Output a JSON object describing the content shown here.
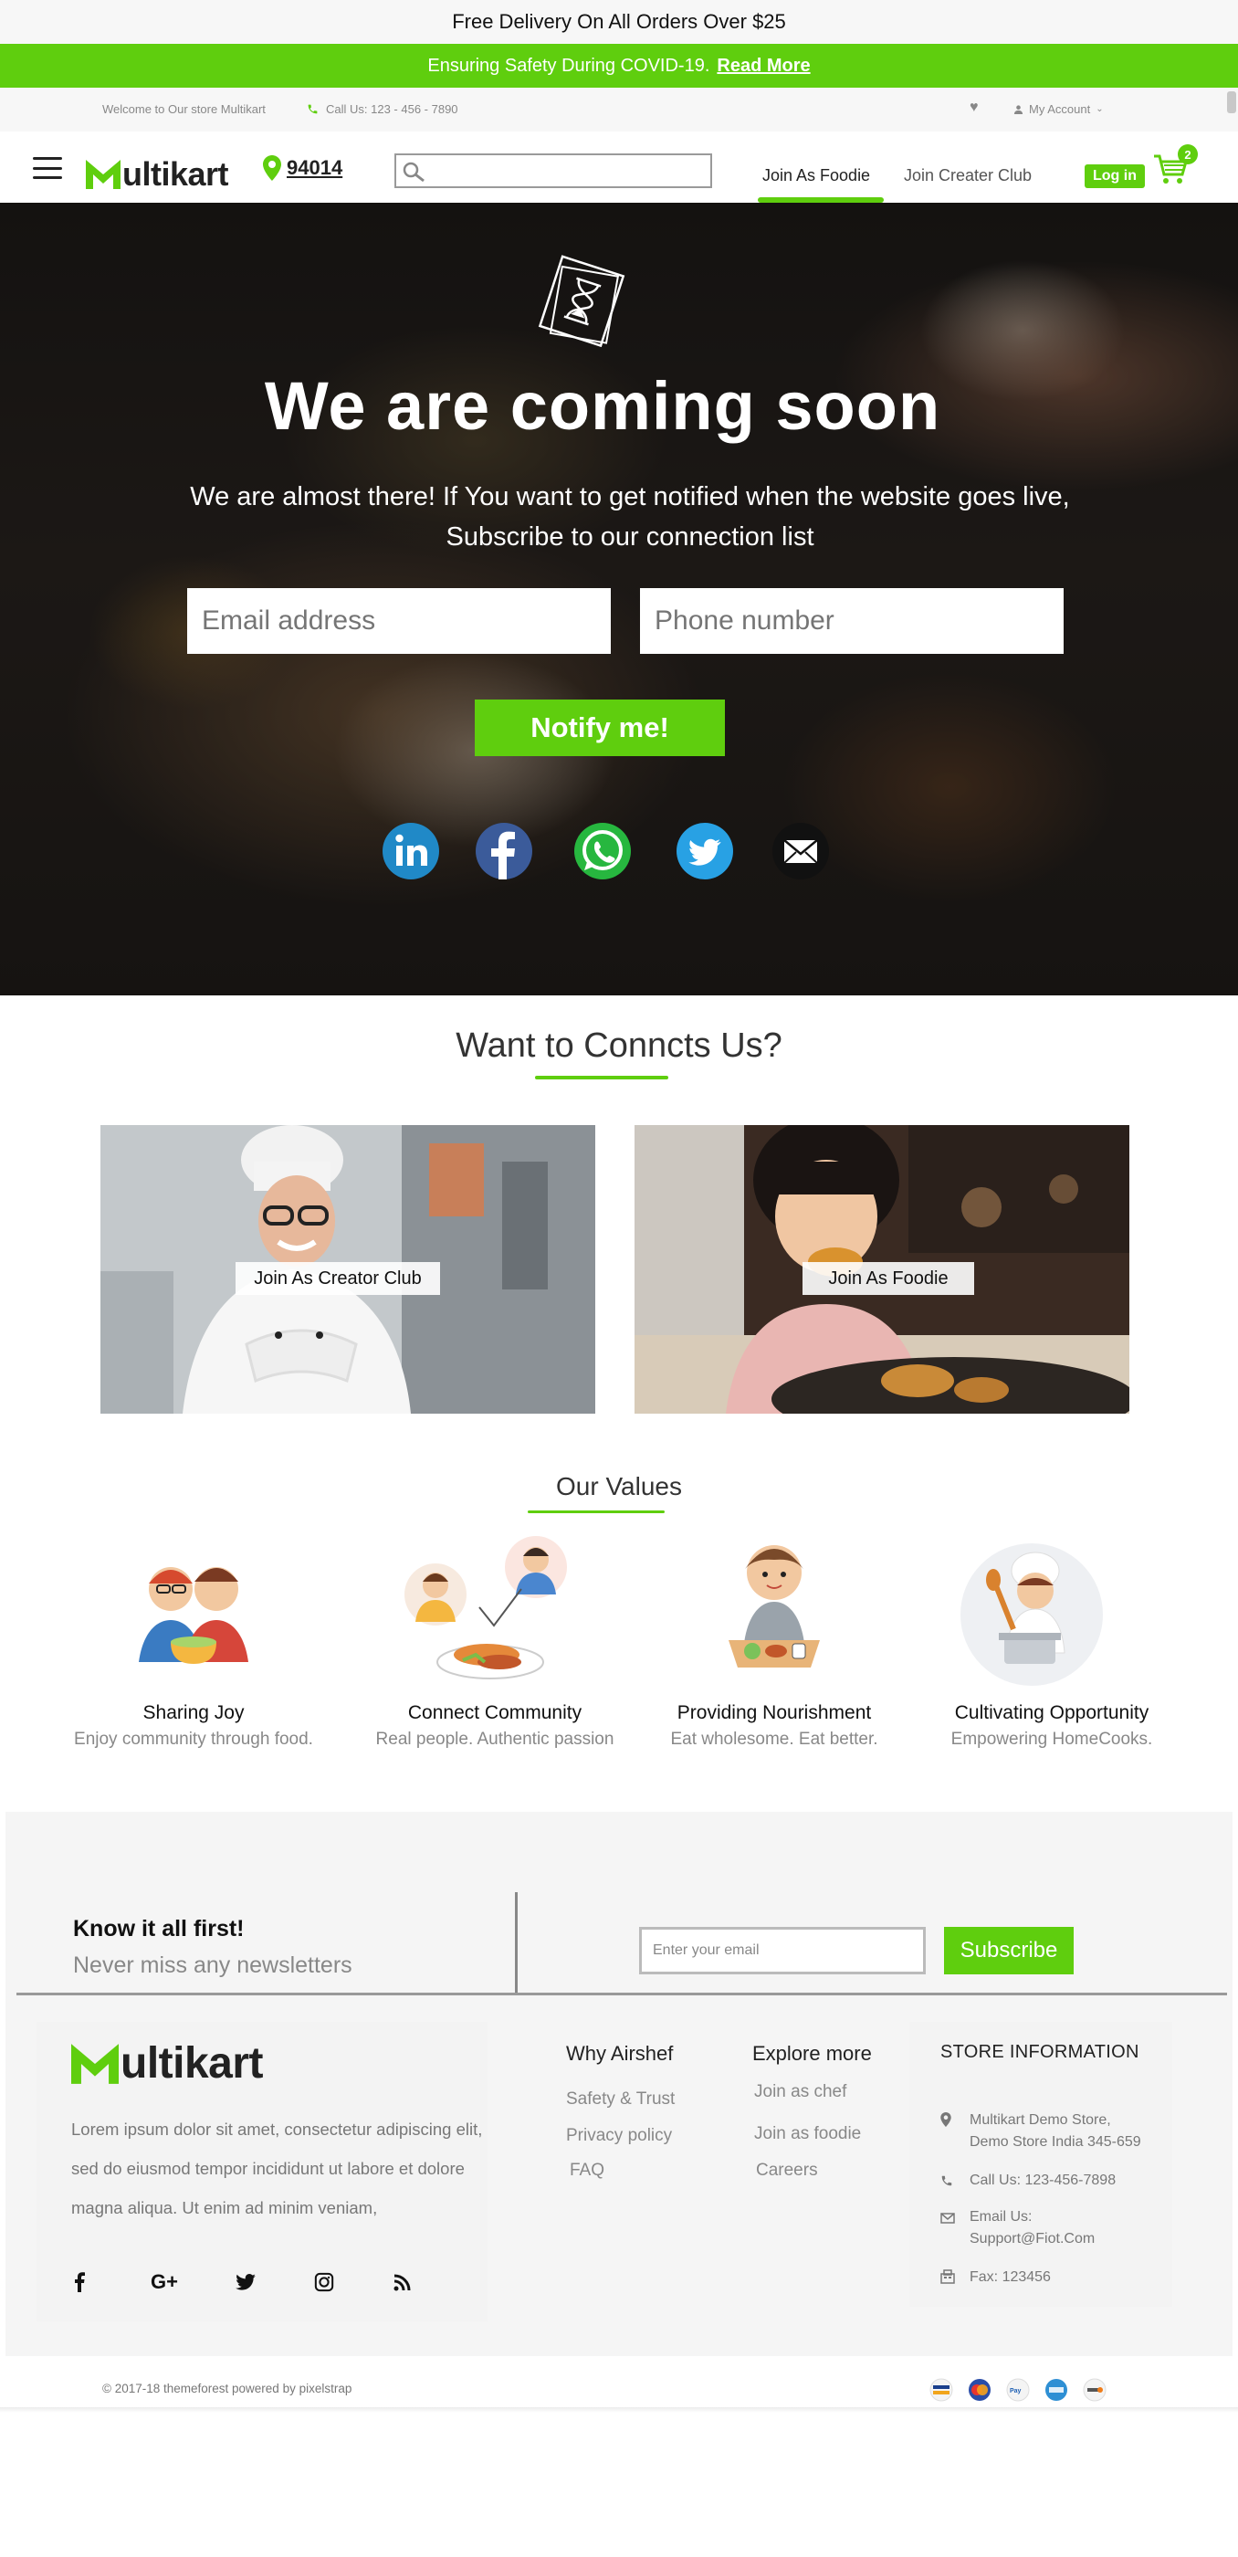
{
  "top_banner": {
    "text": "Free Delivery On All Orders Over $25"
  },
  "covid_bar": {
    "text": "Ensuring Safety During COVID-19.",
    "link": "Read More"
  },
  "info_bar": {
    "welcome": "Welcome to Our store Multikart",
    "phone": "Call Us: 123 - 456 - 7890",
    "account": "My Account"
  },
  "header": {
    "logo_text": "ultikart",
    "pincode": "94014",
    "search_placeholder": "",
    "nav_foodie": "Join As Foodie",
    "nav_creator": "Join Creater Club",
    "login": "Log in",
    "cart_count": "2"
  },
  "hero": {
    "title": "We are coming soon",
    "subtitle_line1": "We are almost there! If You want to get notified when the website goes live,",
    "subtitle_line2": "Subscribe to our connection list",
    "email_placeholder": "Email address",
    "phone_placeholder": "Phone number",
    "notify_button": "Notify me!",
    "social": [
      "linkedin-icon",
      "facebook-icon",
      "whatsapp-icon",
      "twitter-icon",
      "email-icon"
    ]
  },
  "connect": {
    "title": "Want to Conncts Us?",
    "cards": [
      {
        "label": "Join As Creator Club"
      },
      {
        "label": "Join As Foodie"
      }
    ]
  },
  "values": {
    "title": "Our Values",
    "items": [
      {
        "title": "Sharing Joy",
        "subtitle": "Enjoy community through food."
      },
      {
        "title": "Connect Community",
        "subtitle": "Real people. Authentic passion"
      },
      {
        "title": "Providing Nourishment",
        "subtitle": "Eat wholesome. Eat better."
      },
      {
        "title": "Cultivating Opportunity",
        "subtitle": "Empowering HomeCooks."
      }
    ]
  },
  "newsletter": {
    "title": "Know it all first!",
    "subtitle": "Never miss any newsletters",
    "placeholder": "Enter your email",
    "button": "Subscribe"
  },
  "footer": {
    "logo_text": "ultikart",
    "about": "Lorem ipsum dolor sit amet, consectetur adipiscing elit, sed do eiusmod tempor incididunt ut labore et dolore magna aliqua. Ut enim ad minim veniam,",
    "social": [
      "facebook-icon",
      "google-plus-icon",
      "twitter-icon",
      "instagram-icon",
      "rss-icon"
    ],
    "why_title": "Why Airshef",
    "why_links": [
      "Safety & Trust",
      "Privacy policy",
      "FAQ"
    ],
    "explore_title": "Explore more",
    "explore_links": [
      "Join as chef",
      "Join as foodie",
      "Careers"
    ],
    "store_title": "STORE INFORMATION",
    "store_address_1": "Multikart Demo Store,",
    "store_address_2": "Demo Store India 345-659",
    "store_phone": "Call Us: 123-456-7898",
    "store_email_1": "Email Us:",
    "store_email_2": "Support@Fiot.Com",
    "store_fax": "Fax: 123456",
    "copyright": "© 2017-18 themeforest powered by pixelstrap",
    "payments": [
      "visa-icon",
      "mastercard-icon",
      "paypal-icon",
      "amex-icon",
      "discover-icon"
    ]
  },
  "colors": {
    "accent": "#5fce0e",
    "dark": "#222222",
    "muted": "#888888"
  }
}
